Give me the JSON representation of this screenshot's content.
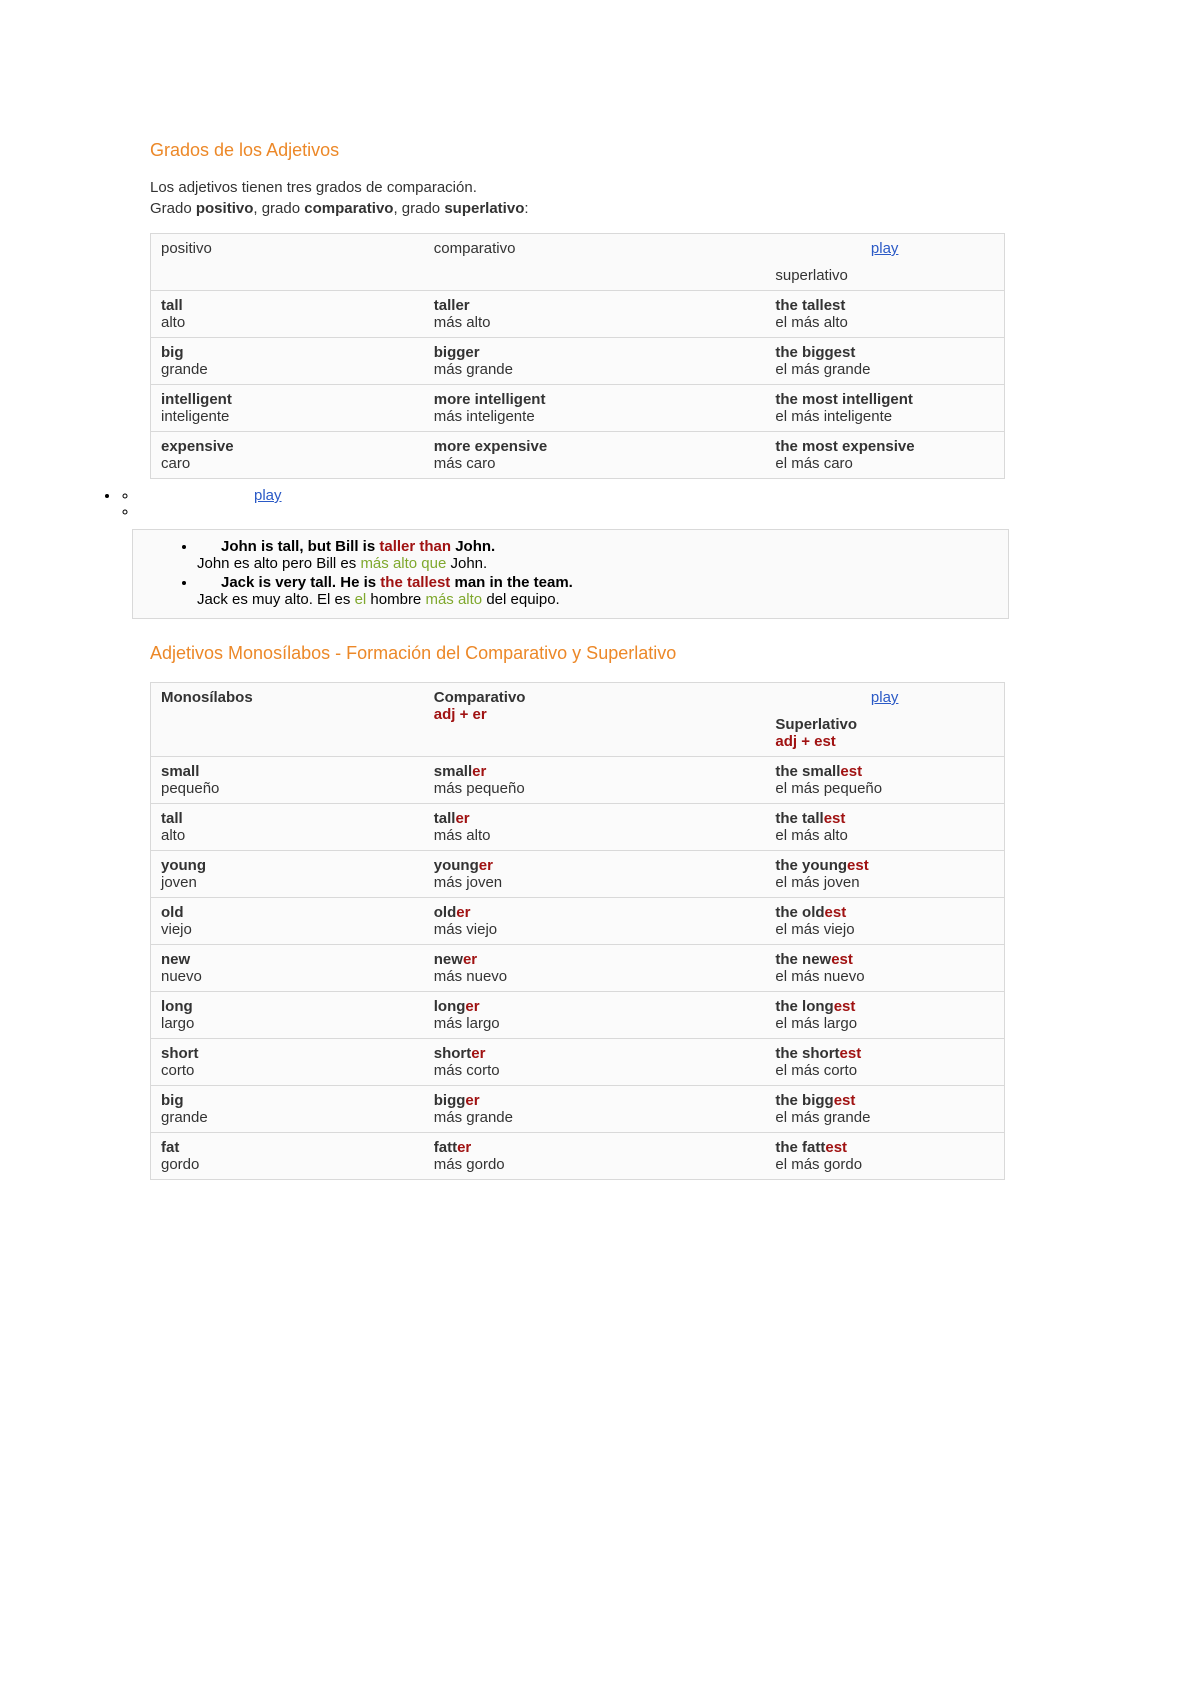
{
  "title1": "Grados de los Adjetivos",
  "intro1": "Los adjetivos tienen tres grados de comparación.",
  "intro2_pre": "Grado ",
  "intro2_b1": "positivo",
  "intro2_mid1": ", grado ",
  "intro2_b2": "comparativo",
  "intro2_mid2": ", grado ",
  "intro2_b3": "superlativo",
  "intro2_end": ":",
  "play_label": "play",
  "grades_headers": {
    "c1": "positivo",
    "c2": "comparativo",
    "c3": "superlativo"
  },
  "grades_rows": [
    {
      "p_en": "tall",
      "p_es": "alto",
      "c_en": "taller",
      "c_es": "más alto",
      "s_en": "the tallest",
      "s_es": "el más alto"
    },
    {
      "p_en": "big",
      "p_es": "grande",
      "c_en": "bigger",
      "c_es": "más grande",
      "s_en": "the biggest",
      "s_es": "el más grande"
    },
    {
      "p_en": "intelligent",
      "p_es": "inteligente",
      "c_en": "more intelligent",
      "c_es": "más inteligente",
      "s_en": "the most intelligent",
      "s_es": "el más inteligente"
    },
    {
      "p_en": "expensive",
      "p_es": "caro",
      "c_en": "more expensive",
      "c_es": "más caro",
      "s_en": "the most expensive",
      "s_es": "el más caro"
    }
  ],
  "examples": [
    {
      "en_pre": "John is tall, but Bill is ",
      "en_hl": "taller than",
      "en_post": " John.",
      "es_pre": "John es alto pero Bill es ",
      "es_hl": "más alto que",
      "es_post": " John."
    },
    {
      "en_pre": "Jack is very tall. He is ",
      "en_hl": "the tallest",
      "en_post": " man in the team.",
      "es_pre": "Jack es muy alto. El es ",
      "es_hl": "el",
      "es_mid": " hombre ",
      "es_hl2": "más alto",
      "es_post": " del equipo."
    }
  ],
  "title2": "Adjetivos Monosílabos - Formación del Comparativo y Superlativo",
  "mono_headers": {
    "c1": "Monosílabos",
    "c2": "Comparativo",
    "c2_sub": "adj + er",
    "c3": "Superlativo",
    "c3_sub": "adj + est"
  },
  "mono_rows": [
    {
      "p_en": "small",
      "p_es": "pequeño",
      "c_st": "small",
      "c_sfx": "er",
      "c_es": "más pequeño",
      "s_pre": "the ",
      "s_st": "small",
      "s_sfx": "est",
      "s_es": "el más pequeño"
    },
    {
      "p_en": "tall",
      "p_es": "alto",
      "c_st": "tall",
      "c_sfx": "er",
      "c_es": "más alto",
      "s_pre": "the ",
      "s_st": "tall",
      "s_sfx": "est",
      "s_es": "el más alto"
    },
    {
      "p_en": "young",
      "p_es": "joven",
      "c_st": "young",
      "c_sfx": "er",
      "c_es": "más joven",
      "s_pre": "the ",
      "s_st": "young",
      "s_sfx": "est",
      "s_es": "el más joven"
    },
    {
      "p_en": "old",
      "p_es": "viejo",
      "c_st": "old",
      "c_sfx": "er",
      "c_es": "más viejo",
      "s_pre": "the ",
      "s_st": "old",
      "s_sfx": "est",
      "s_es": "el más viejo"
    },
    {
      "p_en": "new",
      "p_es": "nuevo",
      "c_st": "new",
      "c_sfx": "er",
      "c_es": "más nuevo",
      "s_pre": "the ",
      "s_st": "new",
      "s_sfx": "est",
      "s_es": "el más nuevo"
    },
    {
      "p_en": "long",
      "p_es": "largo",
      "c_st": "long",
      "c_sfx": "er",
      "c_es": "más largo",
      "s_pre": "the ",
      "s_st": "long",
      "s_sfx": "est",
      "s_es": "el más largo"
    },
    {
      "p_en": "short",
      "p_es": "corto",
      "c_st": "short",
      "c_sfx": "er",
      "c_es": "más corto",
      "s_pre": "the ",
      "s_st": "short",
      "s_sfx": "est",
      "s_es": "el más corto"
    },
    {
      "p_en": "big",
      "p_es": "grande",
      "c_st": "bigg",
      "c_sfx": "er",
      "c_es": "más grande",
      "s_pre": "the ",
      "s_st": "bigg",
      "s_sfx": "est",
      "s_es": "el más grande"
    },
    {
      "p_en": "fat",
      "p_es": "gordo",
      "c_st": "fatt",
      "c_sfx": "er",
      "c_es": "más gordo",
      "s_pre": "the ",
      "s_st": "fatt",
      "s_sfx": "est",
      "s_es": "el más gordo"
    }
  ]
}
